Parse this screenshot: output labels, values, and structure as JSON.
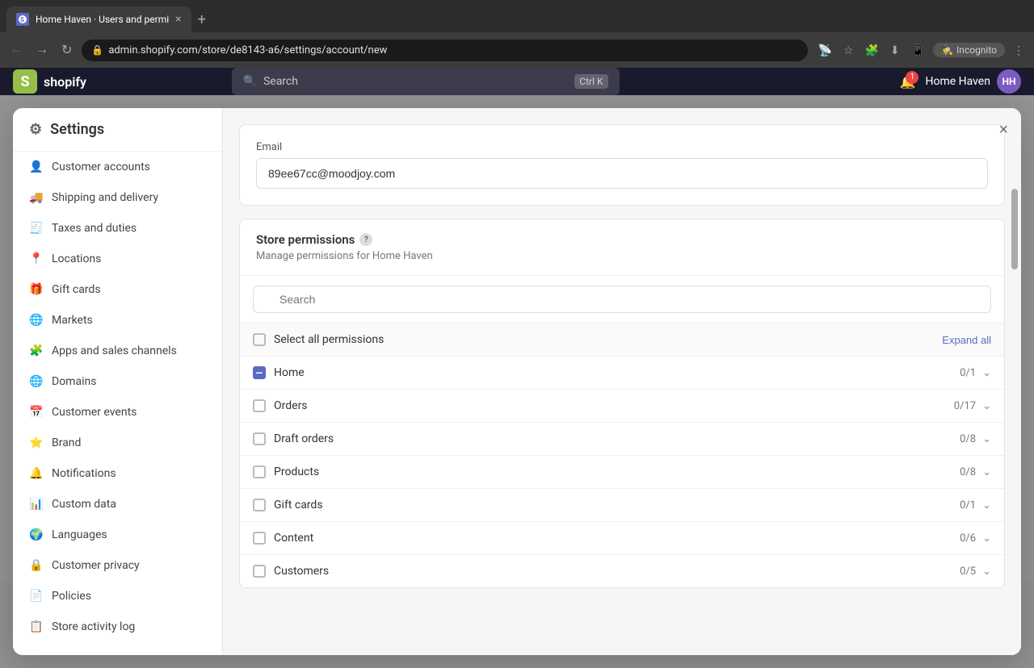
{
  "browser": {
    "tab_title": "Home Haven · Users and permi",
    "url": "admin.shopify.com/store/de8143-a6/settings/account/new",
    "incognito_label": "Incognito",
    "new_tab_label": "+"
  },
  "topbar": {
    "logo_text": "shopify",
    "search_placeholder": "Search",
    "search_shortcut": "Ctrl K",
    "store_name": "Home Haven",
    "store_initials": "HH",
    "notification_count": "1"
  },
  "settings": {
    "title": "Settings",
    "close_label": "×"
  },
  "sidebar": {
    "items": [
      {
        "id": "customer-accounts",
        "label": "Customer accounts",
        "icon": "person"
      },
      {
        "id": "shipping",
        "label": "Shipping and delivery",
        "icon": "truck"
      },
      {
        "id": "taxes",
        "label": "Taxes and duties",
        "icon": "receipt"
      },
      {
        "id": "locations",
        "label": "Locations",
        "icon": "pin"
      },
      {
        "id": "gift-cards",
        "label": "Gift cards",
        "icon": "gift"
      },
      {
        "id": "markets",
        "label": "Markets",
        "icon": "globe"
      },
      {
        "id": "apps",
        "label": "Apps and sales channels",
        "icon": "puzzle"
      },
      {
        "id": "domains",
        "label": "Domains",
        "icon": "domain"
      },
      {
        "id": "customer-events",
        "label": "Customer events",
        "icon": "events"
      },
      {
        "id": "brand",
        "label": "Brand",
        "icon": "star"
      },
      {
        "id": "notifications",
        "label": "Notifications",
        "icon": "bell"
      },
      {
        "id": "custom-data",
        "label": "Custom data",
        "icon": "data"
      },
      {
        "id": "languages",
        "label": "Languages",
        "icon": "language"
      },
      {
        "id": "customer-privacy",
        "label": "Customer privacy",
        "icon": "lock"
      },
      {
        "id": "policies",
        "label": "Policies",
        "icon": "doc"
      },
      {
        "id": "store-activity",
        "label": "Store activity log",
        "icon": "activity"
      }
    ]
  },
  "email_section": {
    "label": "Email",
    "value": "89ee67cc@moodjoy.com"
  },
  "permissions": {
    "title": "Store permissions",
    "subtitle": "Manage permissions for Home Haven",
    "search_placeholder": "Search",
    "select_all_label": "Select all permissions",
    "expand_all_label": "Expand all",
    "items": [
      {
        "name": "Home",
        "count": "0/1"
      },
      {
        "name": "Orders",
        "count": "0/17"
      },
      {
        "name": "Draft orders",
        "count": "0/8"
      },
      {
        "name": "Products",
        "count": "0/8"
      },
      {
        "name": "Gift cards",
        "count": "0/1"
      },
      {
        "name": "Content",
        "count": "0/6"
      },
      {
        "name": "Customers",
        "count": "0/5"
      }
    ]
  }
}
